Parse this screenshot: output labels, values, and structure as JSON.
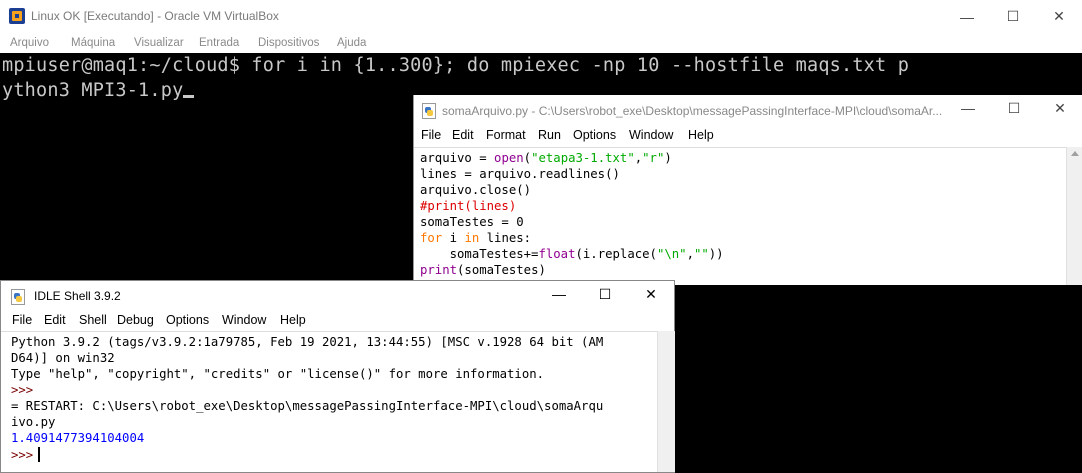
{
  "vbox": {
    "title": "Linux OK [Executando] - Oracle VM VirtualBox",
    "menu": [
      "Arquivo",
      "Máquina",
      "Visualizar",
      "Entrada",
      "Dispositivos",
      "Ajuda"
    ]
  },
  "terminal": {
    "line1": "mpiuser@maq1:~/cloud$ for i in {1..300}; do mpiexec -np 10 --hostfile maqs.txt p",
    "line2": "ython3 MPI3-1.py"
  },
  "editor": {
    "title": "somaArquivo.py - C:\\Users\\robot_exe\\Desktop\\messagePassingInterface-MPI\\cloud\\somaAr...",
    "menu": [
      "File",
      "Edit",
      "Format",
      "Run",
      "Options",
      "Window",
      "Help"
    ],
    "code": {
      "l1_a": "arquivo = ",
      "l1_b": "open",
      "l1_c": "(",
      "l1_d": "\"etapa3-1.txt\"",
      "l1_e": ",",
      "l1_f": "\"r\"",
      "l1_g": ")",
      "l2": "lines = arquivo.readlines()",
      "l3": "arquivo.close()",
      "l4": "#print(lines)",
      "l5": "somaTestes = 0",
      "l6_a": "for",
      "l6_b": " i ",
      "l6_c": "in",
      "l6_d": " lines:",
      "l7_a": "    somaTestes+=",
      "l7_b": "float",
      "l7_c": "(i.replace(",
      "l7_d": "\"\\n\"",
      "l7_e": ",",
      "l7_f": "\"\"",
      "l7_g": "))",
      "l8_a": "print",
      "l8_b": "(somaTestes)"
    }
  },
  "shell": {
    "title": "IDLE Shell 3.9.2",
    "menu": [
      "File",
      "Edit",
      "Shell",
      "Debug",
      "Options",
      "Window",
      "Help"
    ],
    "lines": {
      "l1": "Python 3.9.2 (tags/v3.9.2:1a79785, Feb 19 2021, 13:44:55) [MSC v.1928 64 bit (AM",
      "l2": "D64)] on win32",
      "l3": "Type \"help\", \"copyright\", \"credits\" or \"license()\" for more information.",
      "l4": ">>>",
      "l5": "= RESTART: C:\\Users\\robot_exe\\Desktop\\messagePassingInterface-MPI\\cloud\\somaArqu",
      "l6": "ivo.py",
      "l7": "1.4091477394104004",
      "l8": ">>>"
    }
  },
  "icons": {
    "minimize": "—",
    "maximize": "☐",
    "close": "✕"
  }
}
